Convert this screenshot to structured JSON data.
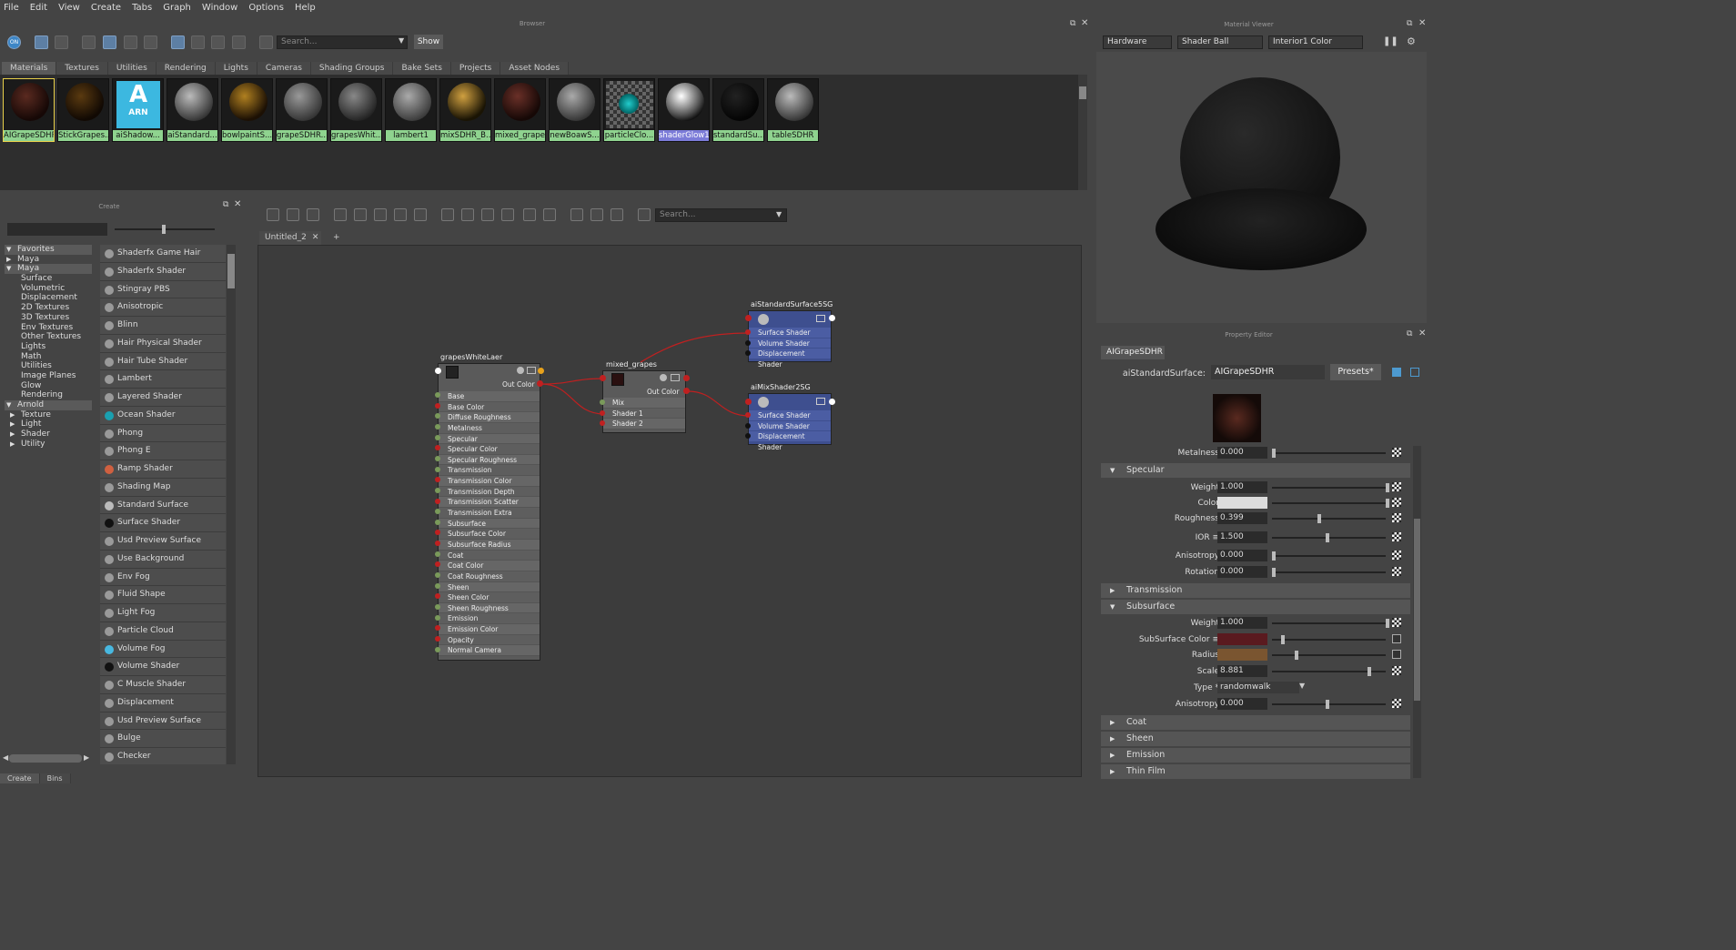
{
  "menu": [
    "File",
    "Edit",
    "View",
    "Create",
    "Tabs",
    "Graph",
    "Window",
    "Options",
    "Help"
  ],
  "browser": {
    "title": "Browser",
    "search_placeholder": "Search...",
    "show_label": "Show",
    "tabs": [
      "Materials",
      "Textures",
      "Utilities",
      "Rendering",
      "Lights",
      "Cameras",
      "Shading Groups",
      "Bake Sets",
      "Projects",
      "Asset Nodes"
    ],
    "swatches": [
      "AIGrapeSDHR",
      "StickGrapes...",
      "aiShadow...",
      "aiStandard...",
      "bowlpaintS...",
      "grapeSDHR...",
      "grapesWhit...",
      "lambert1",
      "mixSDHR_B...",
      "mixed_grapes",
      "newBoawS...",
      "particleClo...",
      "shaderGlow1",
      "standardSu...",
      "tableSDHR"
    ],
    "arn_label": "ARN",
    "arn_letter": "A"
  },
  "create": {
    "title": "Create",
    "tree": [
      "Favorites",
      "Maya",
      "Maya",
      "Surface",
      "Volumetric",
      "Displacement",
      "2D Textures",
      "3D Textures",
      "Env Textures",
      "Other Textures",
      "Lights",
      "Math",
      "Utilities",
      "Image Planes",
      "Glow",
      "Rendering",
      "Arnold",
      "Texture",
      "Light",
      "Shader",
      "Utility"
    ],
    "list": [
      "Shaderfx Game Hair",
      "Shaderfx Shader",
      "Stingray PBS",
      "Anisotropic",
      "Blinn",
      "Hair Physical Shader",
      "Hair Tube Shader",
      "Lambert",
      "Layered Shader",
      "Ocean Shader",
      "Phong",
      "Phong E",
      "Ramp Shader",
      "Shading Map",
      "Standard Surface",
      "Surface Shader",
      "Usd Preview Surface",
      "Use Background",
      "Env Fog",
      "Fluid Shape",
      "Light Fog",
      "Particle Cloud",
      "Volume Fog",
      "Volume Shader",
      "C Muscle Shader",
      "Displacement",
      "Usd Preview Surface",
      "Bulge",
      "Checker"
    ],
    "bottom_tabs": [
      "Create",
      "Bins"
    ]
  },
  "graph": {
    "search_placeholder": "Search...",
    "tab": "Untitled_2",
    "tab_plus": "+",
    "node1": {
      "name": "grapesWhiteLaer",
      "out": "Out Color",
      "rows": [
        "Base",
        "Base Color",
        "Diffuse Roughness",
        "Metalness",
        "Specular",
        "Specular Color",
        "Specular Roughness",
        "Transmission",
        "Transmission Color",
        "Transmission Depth",
        "Transmission Scatter",
        "Transmission Extra Roughness",
        "Subsurface",
        "Subsurface Color",
        "Subsurface Radius",
        "Coat",
        "Coat Color",
        "Coat Roughness",
        "Sheen",
        "Sheen Color",
        "Sheen Roughness",
        "Emission",
        "Emission Color",
        "Opacity",
        "Normal Camera"
      ]
    },
    "node2": {
      "name": "mixed_grapes",
      "out": "Out Color",
      "rows": [
        "Mix",
        "Shader 1",
        "Shader 2"
      ]
    },
    "sg1": {
      "name": "aiStandardSurface5SG",
      "rows": [
        "Surface Shader",
        "Volume Shader",
        "Displacement Shader"
      ]
    },
    "sg2": {
      "name": "aiMixShader2SG",
      "rows": [
        "Surface Shader",
        "Volume Shader",
        "Displacement Shader"
      ]
    }
  },
  "viewer": {
    "title": "Material Viewer",
    "renderer": "Hardware",
    "shape": "Shader Ball",
    "env": "Interior1 Color"
  },
  "props": {
    "title": "Property Editor",
    "tab": "AIGrapeSDHR",
    "type_label": "aiStandardSurface:",
    "name": "AIGrapeSDHR",
    "presets": "Presets*",
    "metalness": {
      "label": "Metalness",
      "value": "0.000"
    },
    "specular": {
      "title": "Specular",
      "weight": "1.000",
      "roughness": "0.399",
      "ior": "1.500",
      "anisotropy": "0.000",
      "rotation": "0.000"
    },
    "labels": {
      "weight": "Weight",
      "color": "Color",
      "roughness": "Roughness",
      "ior": "IOR ≡",
      "anisotropy": "Anisotropy",
      "rotation": "Rotation",
      "sscolor": "SubSurface Color ≡",
      "radius": "Radius",
      "scale": "Scale",
      "type": "Type *"
    },
    "transmission": "Transmission",
    "subsurface": {
      "title": "Subsurface",
      "weight": "1.000",
      "scale": "8.881",
      "type": "randomwalk",
      "anisotropy": "0.000"
    },
    "collapsed": [
      "Coat",
      "Sheen",
      "Emission",
      "Thin Film"
    ]
  },
  "colors": {
    "accent": "#5d7fa4",
    "swatch_label": "#8fd38f",
    "sg_node": "#3e4f8f",
    "wire": "#c02020",
    "sss_color": "#5a1a1f",
    "radius_color": "#7a5530"
  }
}
